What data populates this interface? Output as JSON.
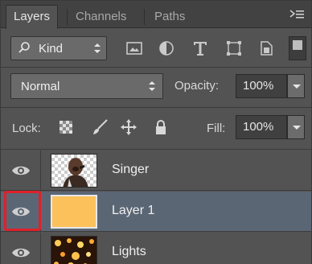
{
  "tabs": [
    {
      "label": "Layers",
      "active": true
    },
    {
      "label": "Channels",
      "active": false
    },
    {
      "label": "Paths",
      "active": false
    }
  ],
  "filter": {
    "kind_label": "Kind",
    "icons": [
      "image-filter-icon",
      "adjustment-filter-icon",
      "type-filter-icon",
      "shape-filter-icon",
      "smart-object-filter-icon"
    ]
  },
  "blend": {
    "mode": "Normal",
    "opacity_label": "Opacity:",
    "opacity_value": "100%"
  },
  "lock": {
    "label": "Lock:",
    "icons": [
      "lock-transparent-pixels-icon",
      "lock-image-pixels-icon",
      "lock-position-icon",
      "lock-all-icon"
    ],
    "fill_label": "Fill:",
    "fill_value": "100%"
  },
  "layers": [
    {
      "name": "Singer",
      "visible": true,
      "selected": false
    },
    {
      "name": "Layer 1",
      "visible": true,
      "selected": true,
      "fill_color": "#fcc15b"
    },
    {
      "name": "Lights",
      "visible": true,
      "selected": false
    }
  ],
  "colors": {
    "panel": "#535353",
    "selected_row": "#5b6675",
    "highlight": "#e0202a"
  }
}
